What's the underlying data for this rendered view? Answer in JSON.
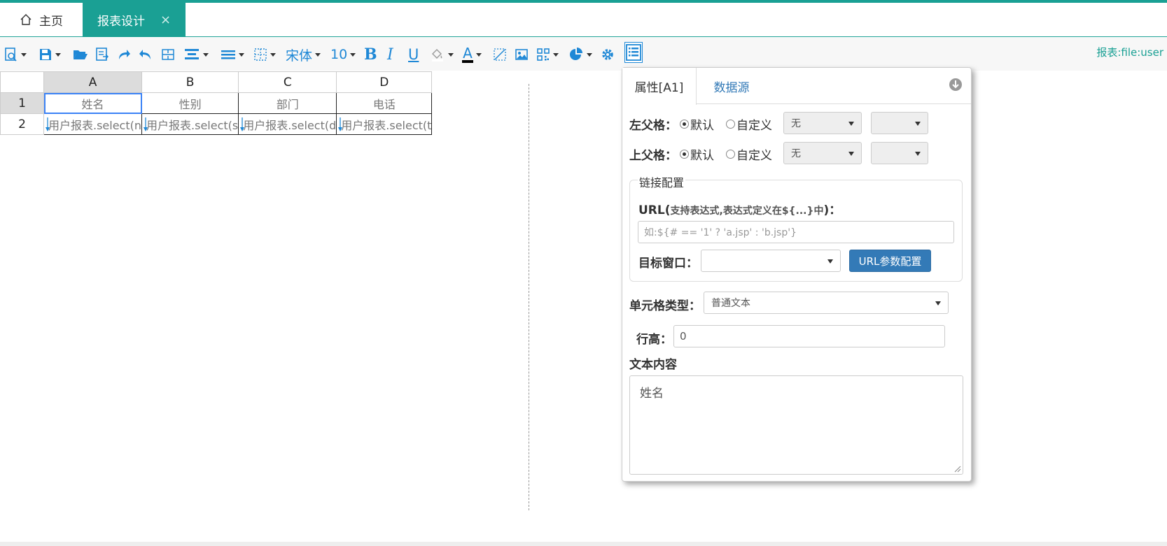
{
  "tabs": {
    "home_label": "主页",
    "design_label": "报表设计",
    "close_glyph": "×"
  },
  "toolbar": {
    "font_name": "宋体",
    "font_size": "10",
    "bold": "B",
    "italic": "I",
    "underline": "U",
    "font_color_glyph": "A",
    "report_label": "报表:file:user"
  },
  "sheet": {
    "columns": [
      "A",
      "B",
      "C",
      "D"
    ],
    "rows": [
      "1",
      "2"
    ],
    "row1": [
      "姓名",
      "性别",
      "部门",
      "电话"
    ],
    "row2": [
      "用户报表.select(n",
      "用户报表.select(s",
      "用户报表.select(d",
      "用户报表.select(t"
    ]
  },
  "panel": {
    "tab_attr": "属性[A1]",
    "tab_datasource": "数据源",
    "left_parent_label": "左父格：",
    "top_parent_label": "上父格：",
    "radio_default": "默认",
    "radio_custom": "自定义",
    "select_none": "无",
    "link_legend": "链接配置",
    "url_label": "URL(",
    "url_hint": "支持表达式,表达式定义在${...}中",
    "url_label_end": ")：",
    "url_placeholder": "如:${# == '1' ? 'a.jsp' : 'b.jsp'}",
    "target_window_label": "目标窗口：",
    "url_params_button": "URL参数配置",
    "cell_type_label": "单元格类型：",
    "cell_type_value": "普通文本",
    "row_height_label": "行高：",
    "row_height_value": "0",
    "text_content_label": "文本内容",
    "text_content_value": "姓名"
  },
  "colors": {
    "accent": "#1aa094",
    "toolbar_icon": "#1f88d6",
    "primary_button": "#337ab7"
  }
}
